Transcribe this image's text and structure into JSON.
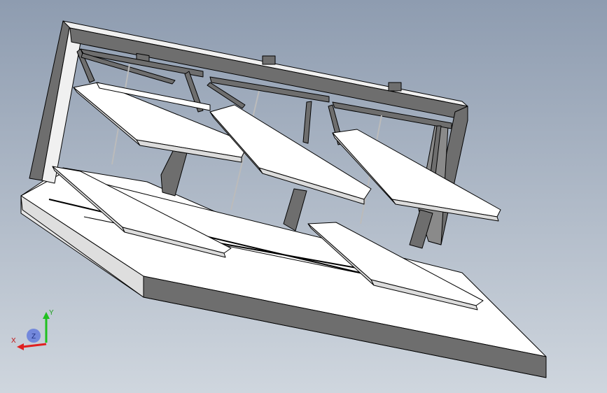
{
  "viewport": {
    "background_top": "#8e9cb0",
    "background_bottom": "#cfd6de"
  },
  "model": {
    "face_light": "#ffffff",
    "face_mid": "#dcdcdc",
    "face_dark": "#6e6e6e",
    "edge": "#000000"
  },
  "triad": {
    "x_label": "X",
    "y_label": "Y",
    "z_label": "Z",
    "x_color": "#e02020",
    "y_color": "#20c020",
    "z_color": "#3050e0"
  }
}
